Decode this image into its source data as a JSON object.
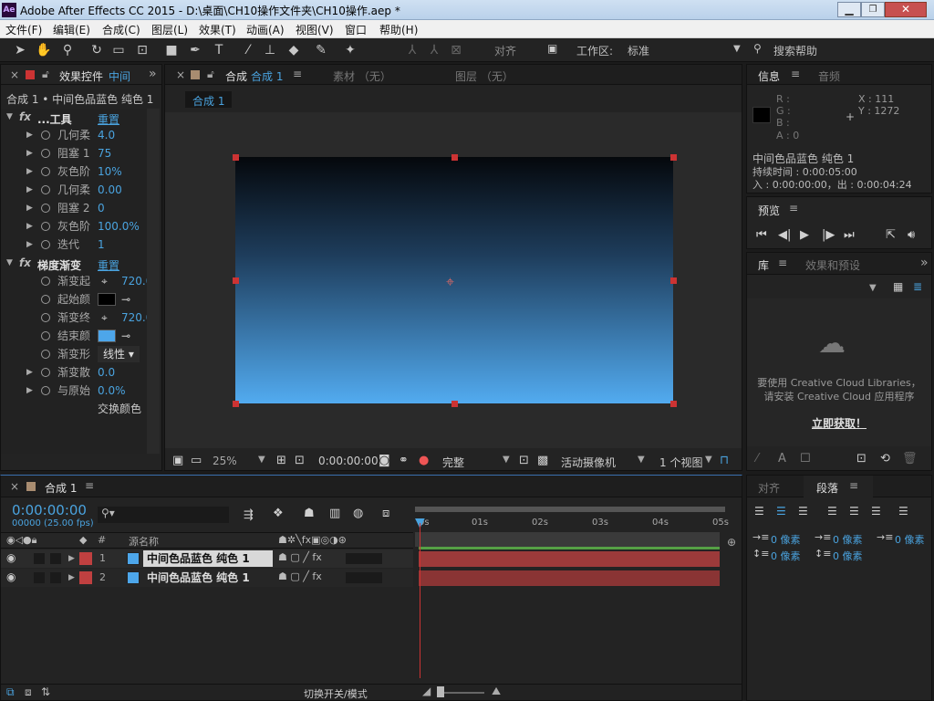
{
  "window": {
    "title": "Adobe After Effects CC 2015 - D:\\桌面\\CH10操作文件夹\\CH10操作.aep *",
    "app_icon": "Ae"
  },
  "menus": [
    "文件(F)",
    "编辑(E)",
    "合成(C)",
    "图层(L)",
    "效果(T)",
    "动画(A)",
    "视图(V)",
    "窗口",
    "帮助(H)"
  ],
  "toolbar": {
    "snap_label": "对齐",
    "workspace_label": "工作区:",
    "workspace_value": "标准",
    "search_placeholder": "搜索帮助"
  },
  "effects_panel": {
    "tab": "效果控件",
    "tab_target": "中间",
    "layer_path": "合成 1 • 中间色品蓝色 纯色 1",
    "effect1": {
      "name": "...工具",
      "reset": "重置",
      "props": [
        {
          "name": "几何柔",
          "value": "4.0"
        },
        {
          "name": "阻塞 1",
          "value": "75"
        },
        {
          "name": "灰色阶",
          "value": "10%"
        },
        {
          "name": "几何柔",
          "value": "0.00"
        },
        {
          "name": "阻塞 2",
          "value": "0"
        },
        {
          "name": "灰色阶",
          "value": "100.0%"
        },
        {
          "name": "迭代",
          "value": "1"
        }
      ]
    },
    "effect2": {
      "name": "梯度渐变",
      "reset": "重置",
      "props": [
        {
          "name": "渐变起",
          "value": "720.0"
        },
        {
          "name": "起始颜",
          "value": ""
        },
        {
          "name": "渐变终",
          "value": "720.0"
        },
        {
          "name": "结束颜",
          "value": ""
        },
        {
          "name": "渐变形",
          "value": "线性"
        },
        {
          "name": "渐变散",
          "value": "0.0"
        },
        {
          "name": "与原始",
          "value": "0.0%"
        }
      ],
      "swap_label": "交换颜色"
    },
    "start_color": "#000000",
    "end_color": "#4da6ea"
  },
  "comp_panel": {
    "tab_prefix": "合成",
    "tab_name": "合成 1",
    "footage_tab": "素材 （无）",
    "layer_tab": "图层 （无）",
    "sub_tab": "合成 1",
    "gradient_top": "#05080c",
    "gradient_bottom": "#52abf0",
    "footer": {
      "zoom": "25%",
      "timecode": "0:00:00:00",
      "quality": "完整",
      "camera": "活动摄像机",
      "views": "1 个视图"
    }
  },
  "info_panel": {
    "tab": "信息",
    "tab2": "音频",
    "r": "R :",
    "g": "G :",
    "b": "B :",
    "a": "A : 0",
    "x": "X : 111",
    "y": "Y : 1272",
    "layer_name": "中间色品蓝色 纯色 1",
    "duration": "持续时间 : 0:00:05:00",
    "inout": "入 : 0:00:00:00，出 : 0:00:04:24"
  },
  "preview_panel": {
    "tab": "预览"
  },
  "library_panel": {
    "tab": "库",
    "tab2": "效果和预设",
    "msg1": "要使用 Creative Cloud Libraries，",
    "msg2": "请安装 Creative Cloud 应用程序",
    "link": "立即获取！"
  },
  "timeline": {
    "tab": "合成 1",
    "timecode": "0:00:00:00",
    "fps": "00000 (25.00 fps)",
    "col_num": "#",
    "col_source": "源名称",
    "ruler": [
      "0s",
      "01s",
      "02s",
      "03s",
      "04s",
      "05s"
    ],
    "layers": [
      {
        "index": "1",
        "name": "中间色品蓝色 纯色 1"
      },
      {
        "index": "2",
        "name": "中间色品蓝色 纯色 1"
      }
    ],
    "footer_label": "切换开关/模式"
  },
  "align_panel": {
    "tab": "对齐",
    "tab2": "段落",
    "units": [
      "0 像素",
      "0 像素",
      "0 像素",
      "0 像素",
      "0 像素"
    ]
  }
}
